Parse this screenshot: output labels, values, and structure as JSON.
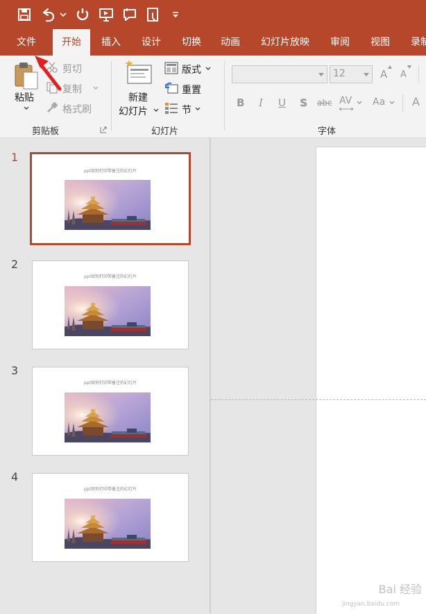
{
  "qat": {
    "icons": [
      "save-icon",
      "undo-icon",
      "chevron-down-icon",
      "redo-repeat-icon",
      "present-from-start-icon",
      "comment-icon",
      "touch-mode-icon",
      "customize-qat-icon"
    ]
  },
  "tabs": [
    {
      "label": "文件"
    },
    {
      "label": "开始"
    },
    {
      "label": "插入"
    },
    {
      "label": "设计"
    },
    {
      "label": "切换"
    },
    {
      "label": "动画"
    },
    {
      "label": "幻灯片放映"
    },
    {
      "label": "审阅"
    },
    {
      "label": "视图"
    },
    {
      "label": "录制"
    }
  ],
  "ribbon": {
    "clipboard": {
      "paste": "粘贴",
      "cut": "剪切",
      "copy": "复制",
      "format_painter": "格式刷",
      "group_label": "剪贴板"
    },
    "slides": {
      "new_slide_line1": "新建",
      "new_slide_line2": "幻灯片",
      "layout": "版式",
      "reset": "重置",
      "section": "节",
      "group_label": "幻灯片"
    },
    "font": {
      "font_name": "",
      "font_size": "12",
      "bold": "B",
      "italic": "I",
      "underline": "U",
      "shadow": "S",
      "strikethrough": "abc",
      "spacing": "AV",
      "case": "Aa",
      "grow": "A",
      "shrink": "A",
      "clear": "A",
      "group_label": "字体"
    }
  },
  "slides": [
    {
      "number": "1",
      "title": "ppt如何打印带备注的幻灯片",
      "selected": true
    },
    {
      "number": "2",
      "title": "ppt如何打印带备注的幻灯片",
      "selected": false
    },
    {
      "number": "3",
      "title": "ppt如何打印带备注的幻灯片",
      "selected": false
    },
    {
      "number": "4",
      "title": "ppt如何打印带备注的幻灯片",
      "selected": false
    }
  ],
  "watermark": {
    "line1": "Bai 经验",
    "line2": "jingyan.baidu.com"
  },
  "colors": {
    "accent": "#b7472a",
    "ribbon_bg": "#f3f3f3",
    "panel_bg": "#e6e6e6"
  }
}
